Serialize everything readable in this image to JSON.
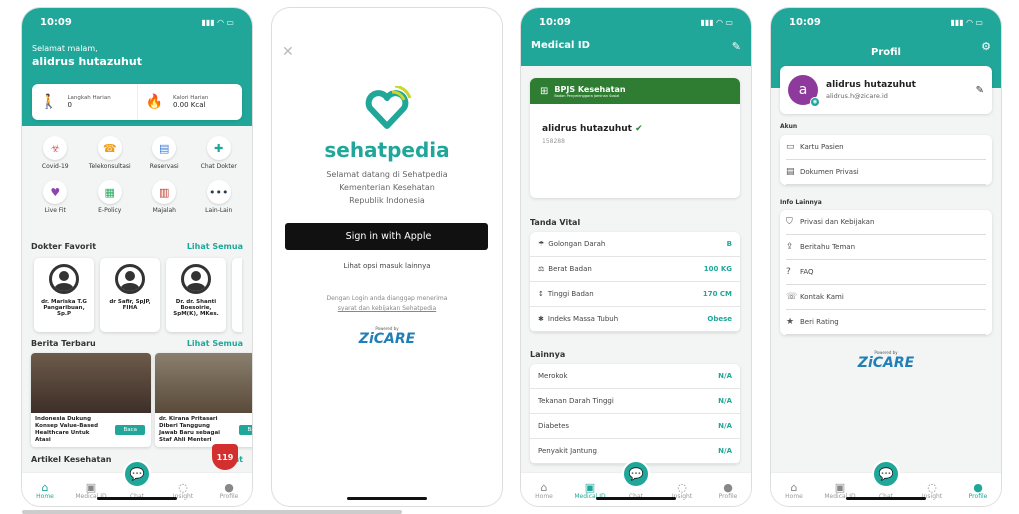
{
  "status_time": "10:09",
  "phone1": {
    "greeting": "Selamat malam,",
    "username": "alidrus hutazuhut",
    "steps": {
      "label": "Langkah Harian",
      "value": "0"
    },
    "calories": {
      "label": "Kalori Harian",
      "value": "0.00 Kcal"
    },
    "menu": [
      {
        "label": "Covid-19",
        "icon": "virus-icon"
      },
      {
        "label": "Telekonsultasi",
        "icon": "teleconsult-icon"
      },
      {
        "label": "Reservasi",
        "icon": "reservation-icon"
      },
      {
        "label": "Chat Dokter",
        "icon": "chat-doctor-icon"
      },
      {
        "label": "Live Fit",
        "icon": "fitness-icon"
      },
      {
        "label": "E-Policy",
        "icon": "policy-icon"
      },
      {
        "label": "Majalah",
        "icon": "magazine-icon"
      },
      {
        "label": "Lain-Lain",
        "icon": "more-icon"
      }
    ],
    "fav_title": "Dokter Favorit",
    "see_all": "Lihat Semua",
    "doctors": [
      {
        "name": "dr. Mariska T.G Pangaribuan, Sp.P"
      },
      {
        "name": "dr Safir, SpJP, FIHA"
      },
      {
        "name": "Dr. dr. Shanti Boesoirie, SpM(K), MKes."
      }
    ],
    "news_title": "Berita Terbaru",
    "news": [
      {
        "title": "Indonesia Dukung Konsep Value-Based Healthcare Untuk Atasi",
        "button": "Baca"
      },
      {
        "title": "dr. Kirana Pritasari Diberi Tanggung Jawab Baru sebagai Staf Ahli Menteri",
        "button": "Baca"
      }
    ],
    "articles_title": "Artikel Kesehatan",
    "articles_link": "Lihat",
    "emergency": "119"
  },
  "phone2": {
    "brand": "sehatpedia",
    "welcome": "Selamat datang di Sehatpedia",
    "ministry": "Kementerian Kesehatan",
    "country": "Republik Indonesia",
    "apple_button": "Sign in with Apple",
    "other_options": "Lihat opsi masuk lainnya",
    "terms_line1": "Dengan Login anda dianggap menerima",
    "terms_line2": "syarat dan kebijakan Sehatpedia",
    "powered": "Powered by",
    "zicare": "ZiCARE"
  },
  "phone3": {
    "title": "Medical ID",
    "bpjs_brand": "BPJS Kesehatan",
    "bpjs_sub": "Badan Penyelenggara Jaminan Sosial",
    "card_name": "alidrus hutazuhut",
    "card_number": "158288",
    "vitals_title": "Tanda Vital",
    "vitals": [
      {
        "label": "Golongan Darah",
        "value": "B"
      },
      {
        "label": "Berat Badan",
        "value": "100 KG"
      },
      {
        "label": "Tinggi Badan",
        "value": "170 CM"
      },
      {
        "label": "Indeks Massa Tubuh",
        "value": "Obese"
      }
    ],
    "other_title": "Lainnya",
    "others": [
      {
        "label": "Merokok",
        "value": "N/A"
      },
      {
        "label": "Tekanan Darah Tinggi",
        "value": "N/A"
      },
      {
        "label": "Diabetes",
        "value": "N/A"
      },
      {
        "label": "Penyakit Jantung",
        "value": "N/A"
      }
    ]
  },
  "phone4": {
    "title": "Profil",
    "avatar_letter": "a",
    "name": "alidrus hutazuhut",
    "email": "alidrus.h@zicare.id",
    "account_title": "Akun",
    "account_items": [
      {
        "label": "Kartu Pasien",
        "icon": "card-icon"
      },
      {
        "label": "Dokumen Privasi",
        "icon": "document-icon"
      }
    ],
    "info_title": "Info Lainnya",
    "info_items": [
      {
        "label": "Privasi dan Kebijakan",
        "icon": "shield-icon"
      },
      {
        "label": "Beritahu Teman",
        "icon": "share-icon"
      },
      {
        "label": "FAQ",
        "icon": "question-icon"
      },
      {
        "label": "Kontak Kami",
        "icon": "phone-icon"
      },
      {
        "label": "Beri Rating",
        "icon": "star-icon"
      }
    ],
    "powered": "Powered by",
    "zicare": "ZiCARE"
  },
  "nav": [
    "Home",
    "Medical ID",
    "Chat",
    "Insight",
    "Profile"
  ],
  "colors": {
    "accent": "#20a79a",
    "bpjs": "#2e7d32",
    "zicare": "#1f7fb6"
  }
}
